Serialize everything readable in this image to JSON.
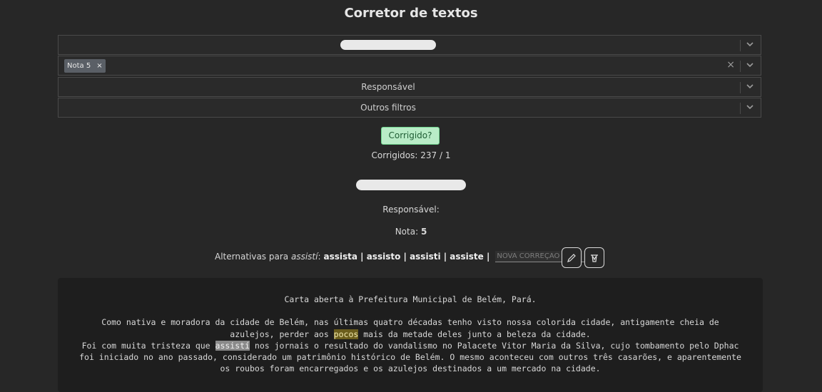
{
  "title": "Corretor de textos",
  "filters": {
    "first_value": "",
    "tag_label": "Nota 5",
    "tag_remove": "×",
    "clear_all": "×",
    "responsavel": "Responsável",
    "outros": "Outros filtros"
  },
  "corrigido_button": "Corrigido?",
  "progress": "Corrigidos: 237 / 1",
  "responsavel_label": "Responsável:",
  "nota": {
    "label": "Nota:",
    "value": "5"
  },
  "alternatives": {
    "prefix": "Alternativas para",
    "word": "assistí",
    "options": "assista | assisto | assisti | assiste |",
    "placeholder": "NOVA CORREÇÃO"
  },
  "text": {
    "heading": "Carta aberta à Prefeitura Municipal de Belém, Pará.",
    "p1_a": "Como nativa e moradora da cidade de Belém, nas últimas quatro décadas tenho visto nossa colorida cidade, antigamente cheia de azulejos, perder aos ",
    "p1_hl": "pocos",
    "p1_b": " mais da metade deles junto a beleza da cidade.",
    "p2_a": "Foi com muita tristeza que ",
    "p2_hl": "assistí",
    "p2_b": " nos jornais o resultado do vandalismo no Palacete Vitor Maria da Silva, cujo tombamento pelo Dphac foi iniciado no ano passado, considerado um patrimônio histórico de Belém. O mesmo aconteceu com outros três casarões, e aparentemente os roubos foram encarregados e os azulejos destinados a um mercado na cidade."
  },
  "colors": {
    "accent_green": "#b9ecc7",
    "highlight_yellow": "#6b5e1c",
    "highlight_gray": "#8a8a8a"
  }
}
